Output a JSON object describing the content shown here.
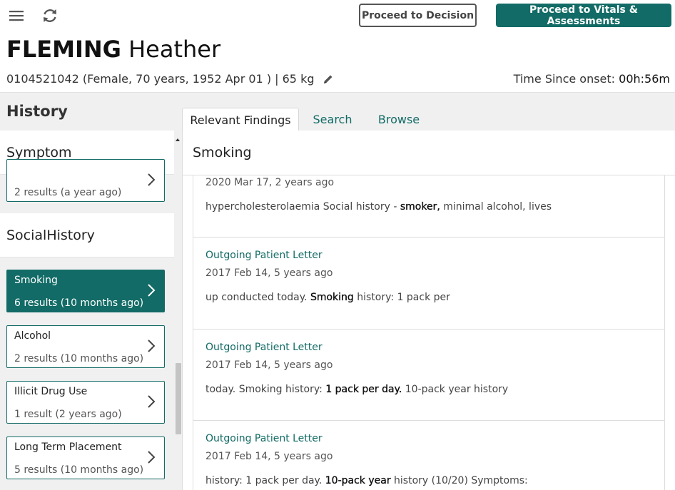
{
  "toolbar": {
    "menu_icon": "hamburger-icon",
    "refresh_icon": "refresh-icon",
    "proceed_decision_label": "Proceed to Decision",
    "proceed_vitals_label": "Proceed to Vitals & Assessments",
    "primary_color": "#126b66"
  },
  "patient": {
    "surname": "FLEMING",
    "given_name": "Heather",
    "details": "0104521042 (Female, 70 years, 1952 Apr 01 ) | 65 kg",
    "edit_icon": "pencil-icon",
    "time_since_label": "Time Since onset:",
    "time_since_value": "00h:56m"
  },
  "history": {
    "title": "History",
    "sections": [
      {
        "name": "Symptom"
      },
      {
        "name": "SocialHistory"
      }
    ],
    "symptom_items": [
      {
        "label": "",
        "count": "2 results (a year ago)"
      }
    ],
    "social_items": [
      {
        "label": "Smoking",
        "count": "6 results (10 months ago)",
        "active": true
      },
      {
        "label": "Alcohol",
        "count": "2 results (10 months ago)"
      },
      {
        "label": "Illicit Drug Use",
        "count": "1 result (2 years ago)"
      },
      {
        "label": "Long Term Placement",
        "count": "5 results (10 months ago)"
      }
    ]
  },
  "tabs": [
    {
      "label": "Relevant Findings",
      "active": true
    },
    {
      "label": "Search"
    },
    {
      "label": "Browse"
    }
  ],
  "findings": {
    "title": "Smoking",
    "results": [
      {
        "source": "",
        "date": "2020 Mar 17, 2 years ago",
        "snippet_before": "hypercholesterolaemia Social history - ",
        "snippet_bold": "smoker,",
        "snippet_after": " minimal alcohol, lives"
      },
      {
        "source": "Outgoing Patient Letter",
        "date": "2017 Feb 14, 5 years ago",
        "snippet_before": "up conducted today. ",
        "snippet_bold": "Smoking",
        "snippet_after": " history: 1 pack per"
      },
      {
        "source": "Outgoing Patient Letter",
        "date": "2017 Feb 14, 5 years ago",
        "snippet_before": "today. Smoking history: ",
        "snippet_bold": "1 pack per day.",
        "snippet_after": " 10-pack year history"
      },
      {
        "source": "Outgoing Patient Letter",
        "date": "2017 Feb 14, 5 years ago",
        "snippet_before": "history: 1 pack per day. ",
        "snippet_bold": "10-pack year",
        "snippet_after": " history (10/20) Symptoms:"
      }
    ]
  }
}
